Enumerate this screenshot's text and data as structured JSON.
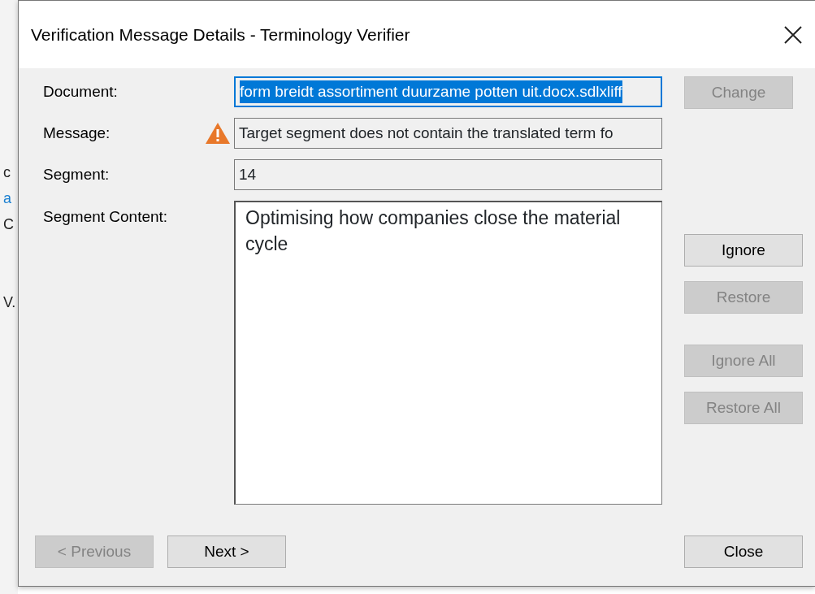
{
  "background_fragments": [
    {
      "text": "c",
      "kind": "text"
    },
    {
      "text": "a",
      "kind": "link"
    },
    {
      "text": "C",
      "kind": "text"
    },
    {
      "text": "V.",
      "kind": "text"
    }
  ],
  "window": {
    "title": "Verification Message Details - Terminology Verifier"
  },
  "fields": [
    {
      "label": "Document:",
      "value": "form breidt assortiment duurzame potten uit.docx.sdlxliff",
      "selected": true
    },
    {
      "label": "Message:",
      "value": "Target segment does not contain the translated term fo",
      "selected": false,
      "kind": "warning"
    },
    {
      "label": "Segment:",
      "value": "14",
      "selected": false
    }
  ],
  "segment_content": {
    "label": "Segment Content:",
    "value": "Optimising how companies close the material cycle"
  },
  "side_buttons": [
    {
      "label": "Change",
      "disabled": true
    },
    {
      "label": "Ignore",
      "disabled": false
    },
    {
      "label": "Restore",
      "disabled": true
    },
    {
      "label": "Ignore All",
      "disabled": true
    },
    {
      "label": "Restore All",
      "disabled": true
    }
  ],
  "nav_buttons": [
    {
      "label": "< Previous",
      "disabled": true
    },
    {
      "label": "Next >",
      "disabled": false
    }
  ],
  "close_button": {
    "label": "Close",
    "disabled": false
  }
}
